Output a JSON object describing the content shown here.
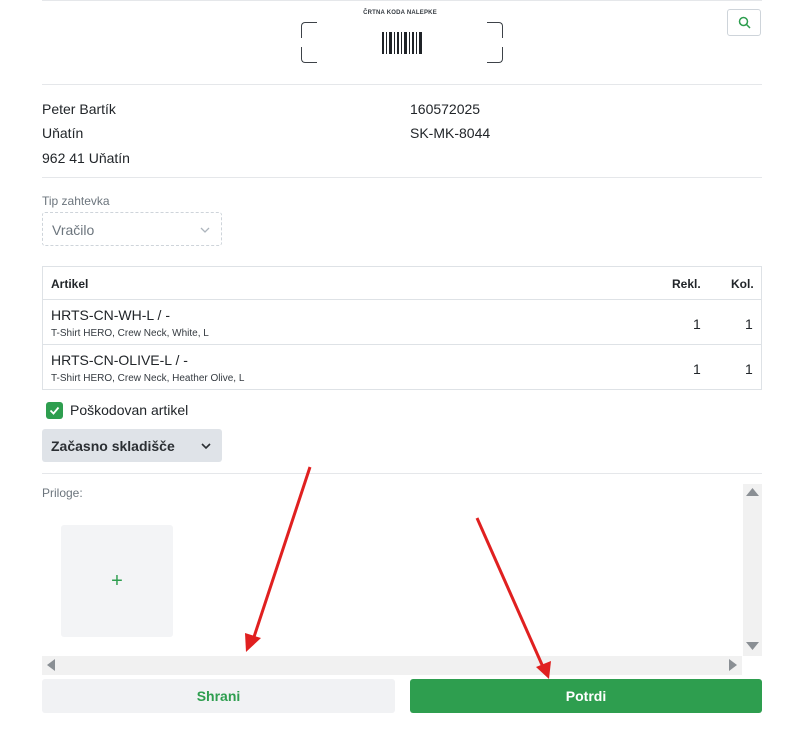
{
  "barcode": {
    "title": "ČRTNA KODA NALEPKE"
  },
  "search": {
    "icon": "search-icon"
  },
  "address": {
    "name": "Peter Bartík",
    "city": "Uňatín",
    "zip_city": "962 41 Uňatín"
  },
  "order": {
    "number": "160572025",
    "code": "SK-MK-8044"
  },
  "request_type": {
    "label": "Tip zahtevka",
    "value": "Vračilo"
  },
  "table": {
    "headers": {
      "article": "Artikel",
      "rekl": "Rekl.",
      "kol": "Kol."
    },
    "rows": [
      {
        "code": "HRTS-CN-WH-L / -",
        "desc": "T-Shirt HERO, Crew Neck, White, L",
        "rekl": "1",
        "kol": "1"
      },
      {
        "code": "HRTS-CN-OLIVE-L / -",
        "desc": "T-Shirt HERO, Crew Neck, Heather Olive, L",
        "rekl": "1",
        "kol": "1"
      }
    ]
  },
  "damaged": {
    "label": "Poškodovan artikel",
    "checked": true
  },
  "storage": {
    "label": "Začasno skladišče"
  },
  "attachments": {
    "label": "Priloge:",
    "add": "+"
  },
  "buttons": {
    "save": "Shrani",
    "confirm": "Potrdi"
  },
  "colors": {
    "accent": "#2e9e4f",
    "arrow": "#e02020"
  }
}
